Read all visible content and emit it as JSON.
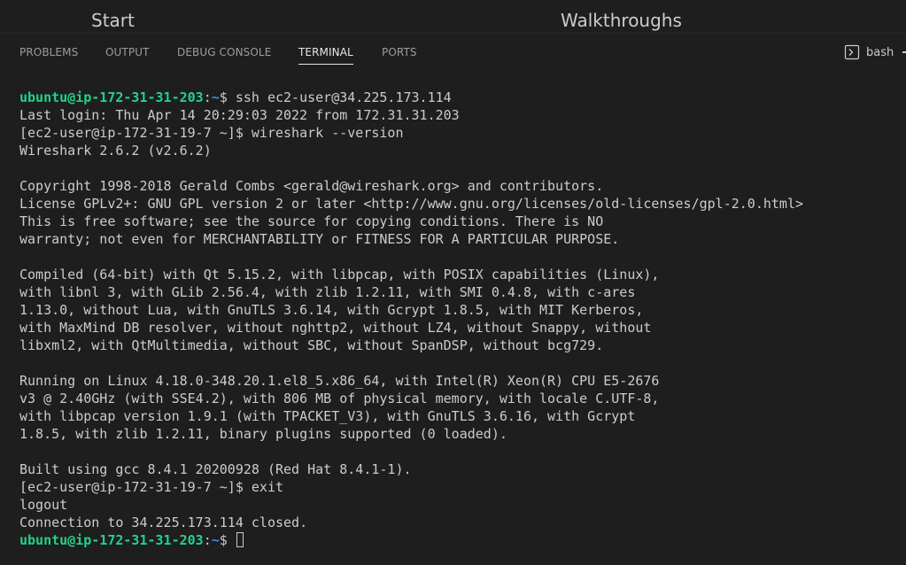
{
  "editor_tabs": [
    {
      "label": "Start"
    },
    {
      "label": "Walkthroughs"
    }
  ],
  "panel": {
    "tabs": [
      {
        "label": "PROBLEMS",
        "active": false
      },
      {
        "label": "OUTPUT",
        "active": false
      },
      {
        "label": "DEBUG CONSOLE",
        "active": false
      },
      {
        "label": "TERMINAL",
        "active": true
      },
      {
        "label": "PORTS",
        "active": false
      }
    ],
    "shell": {
      "label": "bash",
      "icon": "terminal-icon"
    }
  },
  "terminal": {
    "prompt_local": {
      "user": "ubuntu@ip-172-31-31-203",
      "path": "~",
      "symbol": "$"
    },
    "lines": [
      {
        "kind": "prompt",
        "command": " ssh ec2-user@34.225.173.114"
      },
      {
        "kind": "text",
        "text": "Last login: Thu Apr 14 20:29:03 2022 from 172.31.31.203"
      },
      {
        "kind": "text",
        "text": "[ec2-user@ip-172-31-19-7 ~]$ wireshark --version"
      },
      {
        "kind": "text",
        "text": "Wireshark 2.6.2 (v2.6.2)"
      },
      {
        "kind": "text",
        "text": ""
      },
      {
        "kind": "text",
        "text": "Copyright 1998-2018 Gerald Combs <gerald@wireshark.org> and contributors."
      },
      {
        "kind": "text",
        "text": "License GPLv2+: GNU GPL version 2 or later <http://www.gnu.org/licenses/old-licenses/gpl-2.0.html>"
      },
      {
        "kind": "text",
        "text": "This is free software; see the source for copying conditions. There is NO"
      },
      {
        "kind": "text",
        "text": "warranty; not even for MERCHANTABILITY or FITNESS FOR A PARTICULAR PURPOSE."
      },
      {
        "kind": "text",
        "text": ""
      },
      {
        "kind": "text",
        "text": "Compiled (64-bit) with Qt 5.15.2, with libpcap, with POSIX capabilities (Linux),"
      },
      {
        "kind": "text",
        "text": "with libnl 3, with GLib 2.56.4, with zlib 1.2.11, with SMI 0.4.8, with c-ares"
      },
      {
        "kind": "text",
        "text": "1.13.0, without Lua, with GnuTLS 3.6.14, with Gcrypt 1.8.5, with MIT Kerberos,"
      },
      {
        "kind": "text",
        "text": "with MaxMind DB resolver, without nghttp2, without LZ4, without Snappy, without"
      },
      {
        "kind": "text",
        "text": "libxml2, with QtMultimedia, without SBC, without SpanDSP, without bcg729."
      },
      {
        "kind": "text",
        "text": ""
      },
      {
        "kind": "text",
        "text": "Running on Linux 4.18.0-348.20.1.el8_5.x86_64, with Intel(R) Xeon(R) CPU E5-2676"
      },
      {
        "kind": "text",
        "text": "v3 @ 2.40GHz (with SSE4.2), with 806 MB of physical memory, with locale C.UTF-8,"
      },
      {
        "kind": "text",
        "text": "with libpcap version 1.9.1 (with TPACKET_V3), with GnuTLS 3.6.16, with Gcrypt"
      },
      {
        "kind": "text",
        "text": "1.8.5, with zlib 1.2.11, binary plugins supported (0 loaded)."
      },
      {
        "kind": "text",
        "text": ""
      },
      {
        "kind": "text",
        "text": "Built using gcc 8.4.1 20200928 (Red Hat 8.4.1-1)."
      },
      {
        "kind": "text",
        "text": "[ec2-user@ip-172-31-19-7 ~]$ exit"
      },
      {
        "kind": "text",
        "text": "logout"
      },
      {
        "kind": "text",
        "text": "Connection to 34.225.173.114 closed."
      },
      {
        "kind": "prompt",
        "command": " ",
        "cursor": true
      }
    ]
  },
  "colors": {
    "background": "#1e1e1e",
    "prompt_user": "#23d18b",
    "prompt_path": "#3b8eea",
    "text": "#cccccc"
  }
}
